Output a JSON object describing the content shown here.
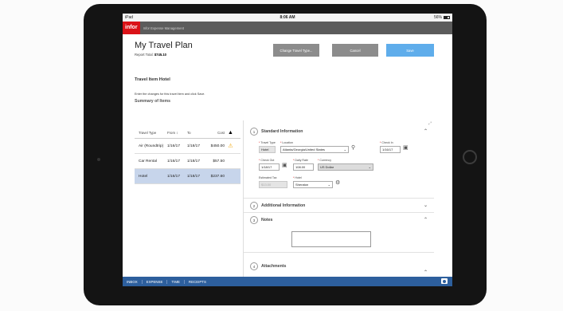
{
  "status": {
    "device": "iPad",
    "time": "8:06 AM",
    "battery": "56%"
  },
  "app": {
    "logo": "infor",
    "name": "Infor Expense Management"
  },
  "header": {
    "title": "My Travel Plan",
    "total_label": "Report Total:",
    "total_value": "$745.10",
    "change_label": "Change Travel Type...",
    "cancel_label": "Cancel",
    "save_label": "Save"
  },
  "left": {
    "travel_item": "Travel Item Hotel",
    "instructions": "Enter the changes for this travel item and click Save.",
    "summary": "Summary of Items",
    "columns": [
      "Travel Type",
      "From",
      "To",
      "Cost"
    ],
    "rows": [
      {
        "type": "Air (Roundtrip)",
        "from": "1/16/17",
        "to": "1/18/17",
        "cost": "$450.00",
        "warn": "⚠"
      },
      {
        "type": "Car Rental",
        "from": "1/16/17",
        "to": "1/18/17",
        "cost": "$57.50",
        "warn": ""
      },
      {
        "type": "Hotel",
        "from": "1/16/17",
        "to": "1/18/17",
        "cost": "$237.60",
        "warn": ""
      }
    ]
  },
  "form": {
    "sections": [
      {
        "num": "1",
        "title": "Standard Information"
      },
      {
        "num": "2",
        "title": "Additional Information"
      },
      {
        "num": "3",
        "title": "Notes"
      },
      {
        "num": "4",
        "title": "Attachments"
      }
    ],
    "travel_type": {
      "label": "Travel Type",
      "value": "Hotel"
    },
    "location": {
      "label": "Location",
      "value": "Atlanta/Georgia/United States"
    },
    "check_in": {
      "label": "Check In",
      "value": "1/16/17"
    },
    "check_out": {
      "label": "Check Out",
      "value": "1/18/17"
    },
    "daily_rate": {
      "label": "Daily Rate",
      "value": "108.00"
    },
    "currency": {
      "label": "Currency",
      "value": "US Dollar"
    },
    "est_tax": {
      "label": "Estimated Tax",
      "value": "$13.00"
    },
    "hotel": {
      "label": "Hotel",
      "value": "Sheraton"
    }
  },
  "nav": {
    "items": [
      "INBOX",
      "EXPENSE",
      "TIME",
      "RECEIPTS"
    ]
  }
}
